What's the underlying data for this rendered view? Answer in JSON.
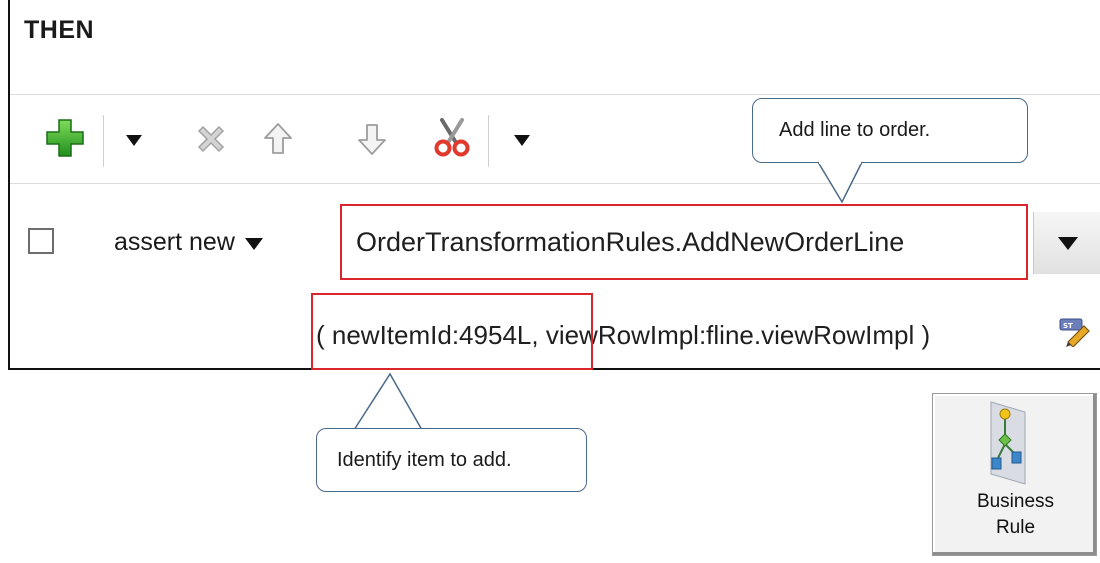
{
  "panel": {
    "title": "THEN"
  },
  "toolbar": {
    "add_icon": "plus-add-icon",
    "add_dropdown_icon": "chevron-down-icon",
    "delete_icon": "delete-x-icon",
    "move_up_icon": "arrow-up-icon",
    "move_down_icon": "arrow-down-icon",
    "cut_icon": "scissors-cut-icon",
    "more_dropdown_icon": "chevron-down-icon"
  },
  "action_row": {
    "checked": false,
    "action_label": "assert new",
    "fact_type": "OrderTransformationRules.AddNewOrderLine",
    "args_open": "( ",
    "arg1": "newItemId:4954L,",
    "arg2": " viewRowImpl:fline.viewRowImpl )",
    "edit_icon": "expression-edit-icon"
  },
  "callouts": {
    "top": "Add line to order.",
    "bottom": "Identify item to add."
  },
  "business_rule_tile": {
    "line1": "Business",
    "line2": "Rule",
    "icon": "business-rule-flow-icon"
  },
  "colors": {
    "highlight_red": "#d8262c",
    "add_green": "#2fa52b",
    "cut_red": "#e03a2f",
    "callout_border": "#4a6a8a"
  }
}
